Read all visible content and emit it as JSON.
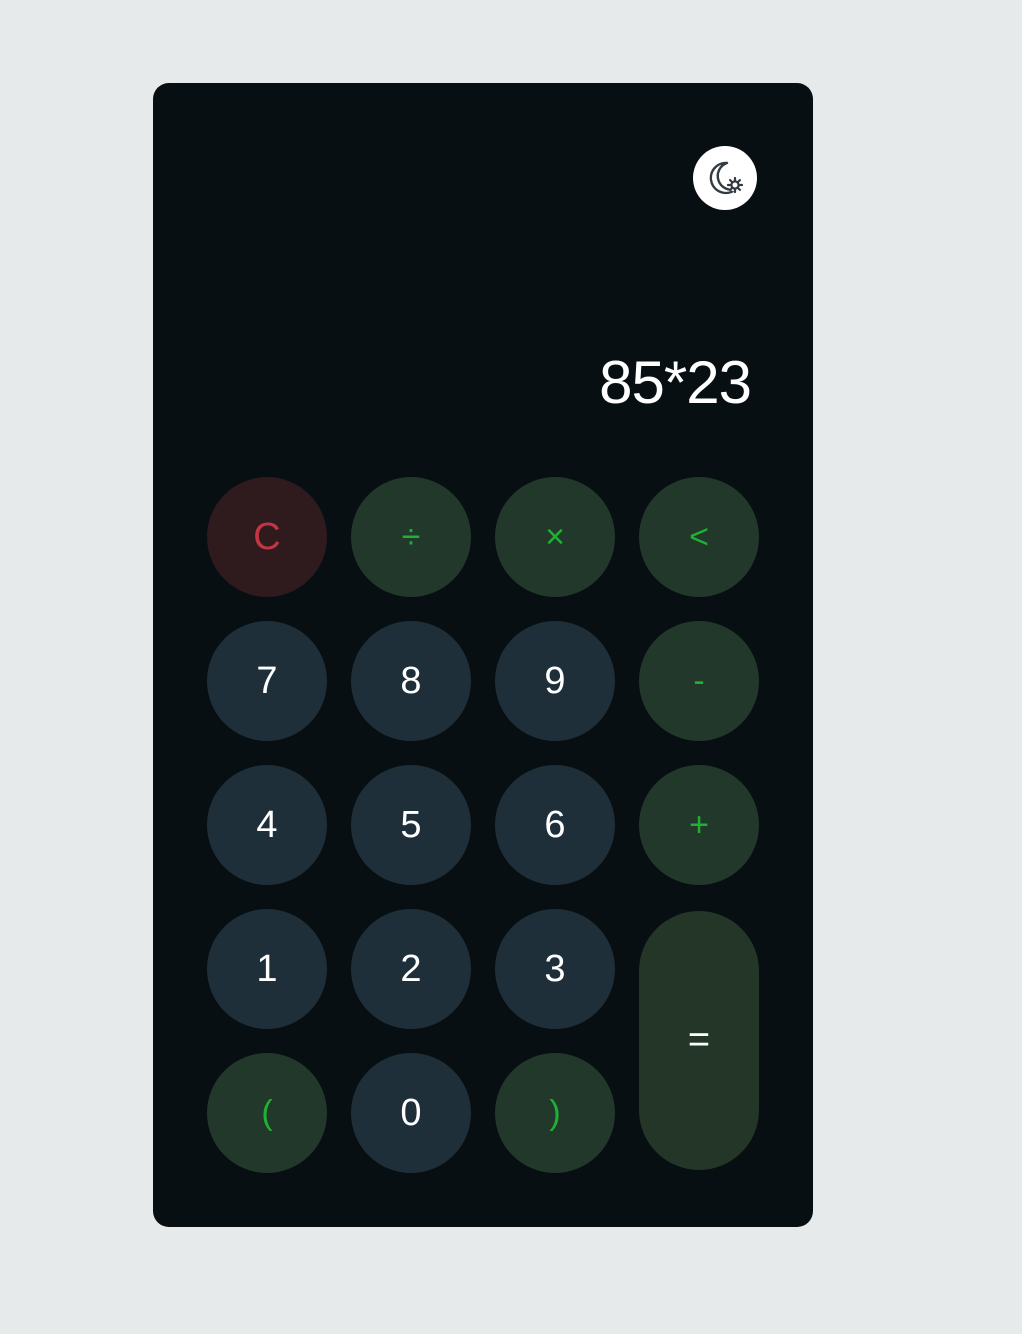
{
  "display": {
    "expression": "85*23"
  },
  "theme_toggle": {
    "icon": "moon-gear-icon"
  },
  "keys": {
    "clear": "C",
    "divide": "÷",
    "multiply": "×",
    "backspace": "<",
    "seven": "7",
    "eight": "8",
    "nine": "9",
    "minus": "-",
    "four": "4",
    "five": "5",
    "six": "6",
    "plus": "+",
    "one": "1",
    "two": "2",
    "three": "3",
    "equals": "=",
    "open_paren": "(",
    "zero": "0",
    "close_paren": ")"
  },
  "colors": {
    "page_background": "#e6eaeb",
    "calculator_background": "#070f13",
    "number_key": "#1e2f39",
    "operator_key": "#22382a",
    "operator_text": "#1fb133",
    "clear_key": "#2f1a1e",
    "clear_text": "#c23542"
  }
}
